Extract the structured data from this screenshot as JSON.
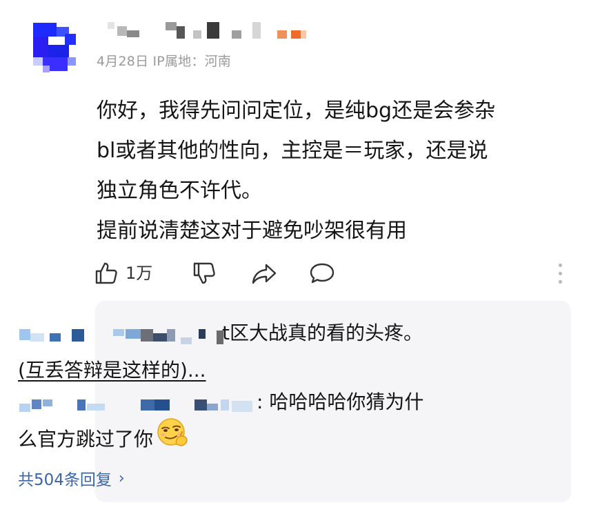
{
  "comment": {
    "meta": "4月28日 IP属地：河南",
    "lines": [
      "你好，我得先问问定位，是纯bg还是会参杂",
      "bl或者其他的性向，主控是＝玩家，还是说",
      "独立角色不许代。",
      "提前说清楚这对于避免吵架很有用"
    ],
    "accent_color": "#2a1ff0"
  },
  "actions": {
    "like_icon": "thumbs-up-icon",
    "like_count": "1万",
    "dislike_icon": "thumbs-down-icon",
    "share_icon": "share-arrow-icon",
    "comment_icon": "speech-bubble-icon",
    "more_icon": "vertical-ellipsis-icon"
  },
  "replies": {
    "reply1_visible": "t区大战真的看的头疼。",
    "reply1_line2_a": "(互丢答辩是",
    "reply1_line2_b": "这样的",
    "reply1_line2_c": ")...",
    "reply2_visible": ": 哈哈哈哈你猜为什",
    "reply2_line2": "么官方跳过了你",
    "reply2_emoji": "smirk-emoji-icon",
    "total_label": "共504条回复",
    "link_color": "#3a66a8"
  }
}
